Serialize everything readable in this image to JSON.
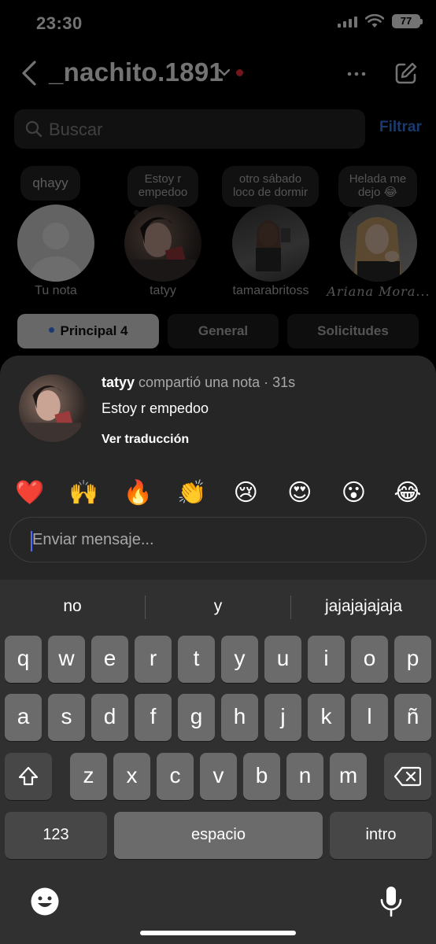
{
  "status_bar": {
    "time": "23:30",
    "battery": "77"
  },
  "header": {
    "username": "_nachito.1891",
    "accent_red": "#ff3040"
  },
  "search": {
    "placeholder": "Buscar",
    "filter_label": "Filtrar"
  },
  "notes": [
    {
      "bubble": "qhayy",
      "name": "Tu nota"
    },
    {
      "bubble": "Estoy r empedoo",
      "name": "tatyy"
    },
    {
      "bubble": "otro sábado loco de dormir",
      "name": "tamarabritoss"
    },
    {
      "bubble": "Helada me dejo 😂",
      "name": "Ariana Mora..."
    }
  ],
  "tabs": [
    {
      "label": "Principal 4",
      "active": true
    },
    {
      "label": "General",
      "active": false
    },
    {
      "label": "Solicitudes",
      "active": false
    }
  ],
  "sheet": {
    "username": "tatyy",
    "action": "compartió una nota · 31s",
    "note_text": "Estoy r empedoo",
    "translate_label": "Ver traducción",
    "reactions": [
      "❤️",
      "🙌",
      "🔥",
      "👏",
      "😢",
      "😍",
      "😮",
      "😂"
    ],
    "message_placeholder": "Enviar mensaje..."
  },
  "keyboard": {
    "suggestions": [
      "no",
      "y",
      "jajajajajaja"
    ],
    "row1": [
      "q",
      "w",
      "e",
      "r",
      "t",
      "y",
      "u",
      "i",
      "o",
      "p"
    ],
    "row2": [
      "a",
      "s",
      "d",
      "f",
      "g",
      "h",
      "j",
      "k",
      "l",
      "ñ"
    ],
    "row3": [
      "z",
      "x",
      "c",
      "v",
      "b",
      "n",
      "m"
    ],
    "numbers_label": "123",
    "space_label": "espacio",
    "return_label": "intro"
  }
}
